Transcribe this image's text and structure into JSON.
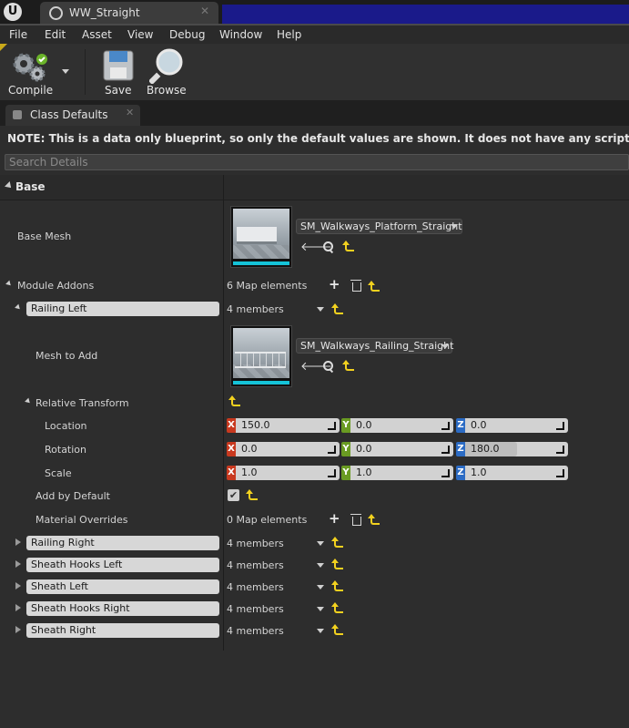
{
  "window": {
    "tab_title": "WW_Straight",
    "logo_text": "U"
  },
  "menu": [
    "File",
    "Edit",
    "Asset",
    "View",
    "Debug",
    "Window",
    "Help"
  ],
  "toolbar": {
    "compile_label": "Compile",
    "save_label": "Save",
    "browse_label": "Browse"
  },
  "panel": {
    "tab_label": "Class Defaults",
    "notice": "NOTE: This is a data only blueprint, so only the default values are shown.  It does not have any script or variables.  If you want to",
    "search_placeholder": "Search Details"
  },
  "details": {
    "category": "Base",
    "base_mesh": {
      "label": "Base Mesh",
      "asset": "SM_Walkways_Platform_Straight"
    },
    "module_addons": {
      "label": "Module Addons",
      "summary": "6 Map elements"
    },
    "railing_left": {
      "key": "Railing Left",
      "members": "4 members",
      "mesh_to_add": {
        "label": "Mesh to Add",
        "asset": "SM_Walkways_Railing_Straight"
      },
      "relative_transform": {
        "label": "Relative Transform",
        "location": {
          "label": "Location",
          "x": "150.0",
          "y": "0.0",
          "z": "0.0"
        },
        "rotation": {
          "label": "Rotation",
          "x": "0.0",
          "y": "0.0",
          "z": "180.0",
          "z_slider_fraction": 0.5
        },
        "scale": {
          "label": "Scale",
          "x": "1.0",
          "y": "1.0",
          "z": "1.0"
        }
      },
      "add_by_default": {
        "label": "Add by Default",
        "checked": true,
        "check_glyph": "✔"
      },
      "material_overrides": {
        "label": "Material Overrides",
        "summary": "0 Map elements"
      }
    },
    "collapsed_entries": [
      {
        "key": "Railing Right",
        "members": "4 members"
      },
      {
        "key": "Sheath Hooks Left",
        "members": "4 members"
      },
      {
        "key": "Sheath Left",
        "members": "4 members"
      },
      {
        "key": "Sheath Hooks Right",
        "members": "4 members"
      },
      {
        "key": "Sheath Right",
        "members": "4 members"
      }
    ],
    "axis_letters": {
      "x": "X",
      "y": "Y",
      "z": "Z"
    }
  },
  "colors": {
    "x_axis": "#c8391f",
    "y_axis": "#6a9b22",
    "z_axis": "#2b6bc4",
    "reset_arrow": "#f2d11f",
    "thumb_accent": "#15c3d8"
  }
}
